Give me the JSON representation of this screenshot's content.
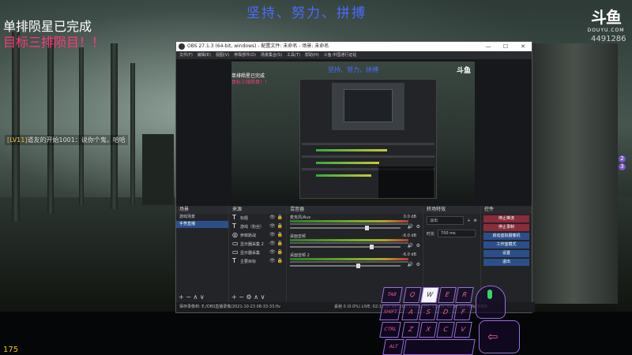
{
  "stream": {
    "banner_title": "坚持、努力、拼搏",
    "overlay_line1": "单排陨星已完成",
    "overlay_line2": "目标三排陨目！！",
    "chat_tag": "[LV11]",
    "chat_text": "道友的开始1001：说你个鬼，哈哈",
    "platform_logo": "斗鱼",
    "platform_sub": "DOUYU.COM",
    "viewer_count": "4491286",
    "side_badges": [
      "2",
      "3"
    ],
    "fps": "175"
  },
  "obs": {
    "window_title": "OBS 27.1.3 (64-bit, windows) - 配置文件: 未命名 - 场景: 未命名",
    "window_controls": [
      "—",
      "☐",
      "✕"
    ],
    "menu": [
      "文件(F)",
      "编辑(E)",
      "视图(V)",
      "停靠部件(D)",
      "场景集合(S)",
      "工具(T)",
      "帮助(H)",
      "斗鱼·中国通行证站"
    ],
    "preview": {
      "title": "坚持、努力、拼搏",
      "line1": "单排陨星已完成",
      "line2": "目标三排陨目！！",
      "logo": "斗鱼"
    },
    "toolbar_props": "属性",
    "toolbar_filters": "滤镜",
    "scenes": {
      "header": "场景",
      "items": [
        {
          "label": "游戏场景",
          "selected": false
        },
        {
          "label": "手势直播",
          "selected": true
        }
      ]
    },
    "sources": {
      "header": "来源",
      "items": [
        {
          "glyph": "T",
          "label": "标题"
        },
        {
          "glyph": "T",
          "label": "游戏（粉丝）"
        },
        {
          "glyph": "◎",
          "label": "伊菲斯战"
        },
        {
          "glyph": "▭",
          "label": "显示器采集 2"
        },
        {
          "glyph": "▭",
          "label": "显示器采集"
        },
        {
          "glyph": "T",
          "label": "主要目标"
        }
      ]
    },
    "mixer": {
      "header": "混音器",
      "channels": [
        {
          "name": "麦克风/Aux",
          "db": "0.0 dB",
          "level": 0.68
        },
        {
          "name": "桌面音频",
          "db": "-6.0 dB",
          "level": 0.72
        },
        {
          "name": "桌面音频 2",
          "db": "-6.0 dB",
          "level": 0.6
        }
      ]
    },
    "transitions": {
      "header": "转场特效",
      "type": "淡出",
      "duration_label": "时长",
      "duration_value": "700 ms"
    },
    "controls": {
      "header": "控件",
      "buttons": [
        {
          "label": "停止推流",
          "style": "red"
        },
        {
          "label": "停止录制",
          "style": "red"
        },
        {
          "label": "启动虚拟摄像机",
          "style": "blue"
        },
        {
          "label": "工作室模式",
          "style": "blue"
        },
        {
          "label": "设置",
          "style": "blue"
        },
        {
          "label": "退出",
          "style": "blue"
        }
      ]
    },
    "status": {
      "left": "保存录像到: E:/OBS直播录像/2021-10-23 08-33-33.flv",
      "right": "丢帧 0 (0.0%)   LIVE: 02:12:01   REC: 02:12:01   CPU: 11.4%, 60.00 fps   kb/s: 6365"
    }
  },
  "keyboard": {
    "rows": [
      [
        "TAB",
        "Q",
        "W",
        "E",
        "R"
      ],
      [
        "SHIFT",
        "A",
        "S",
        "D",
        "F"
      ],
      [
        "CTRL",
        "Z",
        "X",
        "C",
        "V"
      ],
      [
        "ALT"
      ]
    ],
    "pressed": "W"
  }
}
